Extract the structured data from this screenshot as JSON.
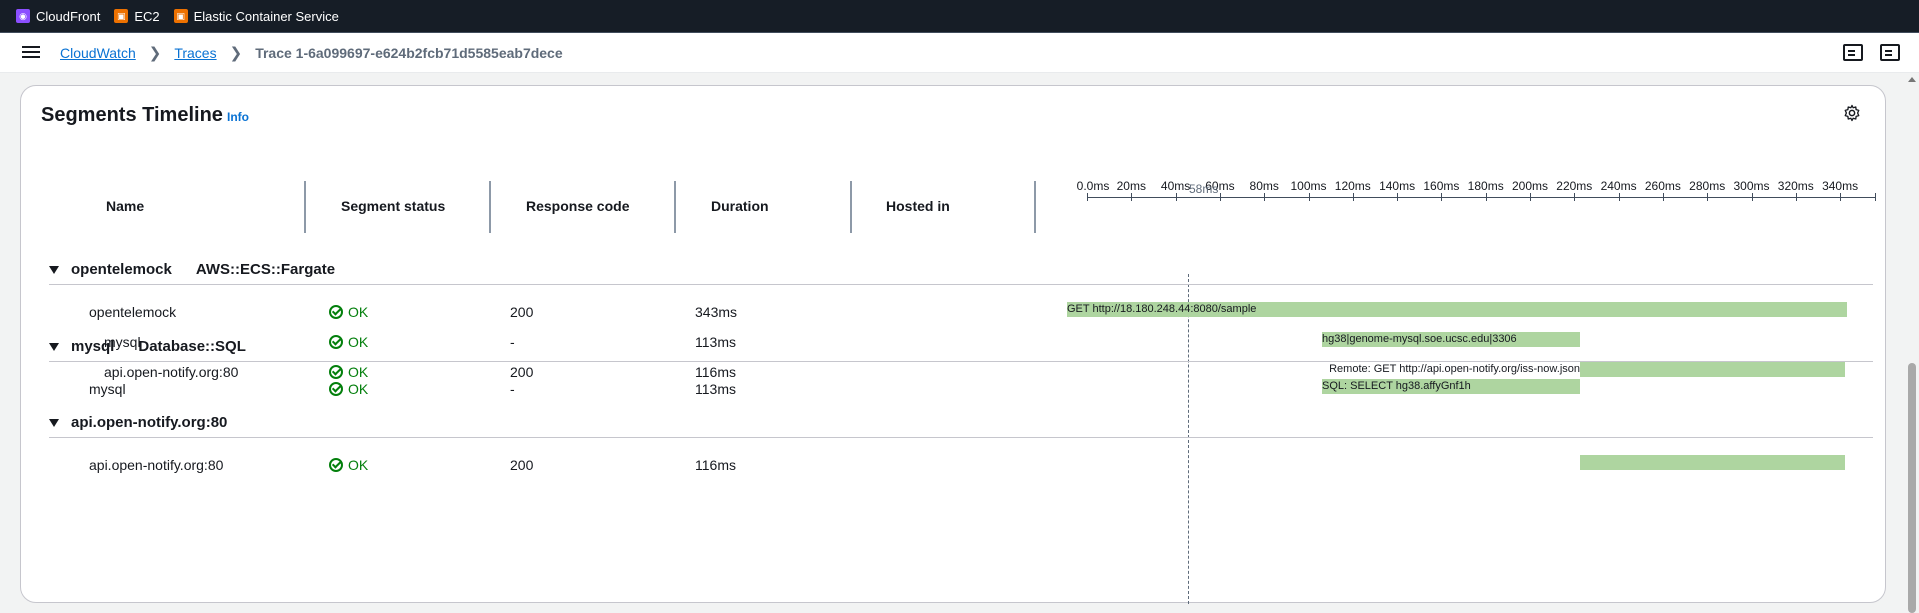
{
  "favorites": [
    {
      "label": "CloudFront",
      "icon": "cloudfront-icon"
    },
    {
      "label": "EC2",
      "icon": "ec2-icon"
    },
    {
      "label": "Elastic Container Service",
      "icon": "ecs-icon"
    }
  ],
  "breadcrumb": {
    "items": [
      "CloudWatch",
      "Traces"
    ],
    "current": "Trace 1-6a099697-e624b2fcb71d5585eab7dece"
  },
  "panel": {
    "title": "Segments Timeline",
    "info": "Info"
  },
  "columns": {
    "name": "Name",
    "status": "Segment status",
    "code": "Response code",
    "duration": "Duration",
    "hosted": "Hosted in"
  },
  "axis": {
    "ticks": [
      "0.0ms",
      "20ms",
      "40ms",
      "60ms",
      "80ms",
      "100ms",
      "120ms",
      "140ms",
      "160ms",
      "180ms",
      "200ms",
      "220ms",
      "240ms",
      "260ms",
      "280ms",
      "300ms",
      "320ms",
      "340ms"
    ],
    "cursor_label": "58ms"
  },
  "groups": [
    {
      "name": "opentelemock",
      "type": "AWS::ECS::Fargate",
      "rows": [
        {
          "name": "opentelemock",
          "status": "OK",
          "code": "200",
          "duration": "343ms",
          "bar_label": "GET http://18.180.248.44:8080/sample"
        },
        {
          "name": "mysql",
          "status": "OK",
          "code": "-",
          "duration": "113ms",
          "bar_label": "hg38|genome-mysql.soe.ucsc.edu|3306"
        },
        {
          "name": "api.open-notify.org:80",
          "status": "OK",
          "code": "200",
          "duration": "116ms",
          "bar_label": "Remote: GET http://api.open-notify.org/iss-now.json"
        }
      ]
    },
    {
      "name": "mysql",
      "type": "Database::SQL",
      "rows": [
        {
          "name": "mysql",
          "status": "OK",
          "code": "-",
          "duration": "113ms",
          "bar_label": "SQL: SELECT hg38.affyGnf1h"
        }
      ]
    },
    {
      "name": "api.open-notify.org:80",
      "type": "",
      "rows": [
        {
          "name": "api.open-notify.org:80",
          "status": "OK",
          "code": "200",
          "duration": "116ms",
          "bar_label": ""
        }
      ]
    }
  ]
}
